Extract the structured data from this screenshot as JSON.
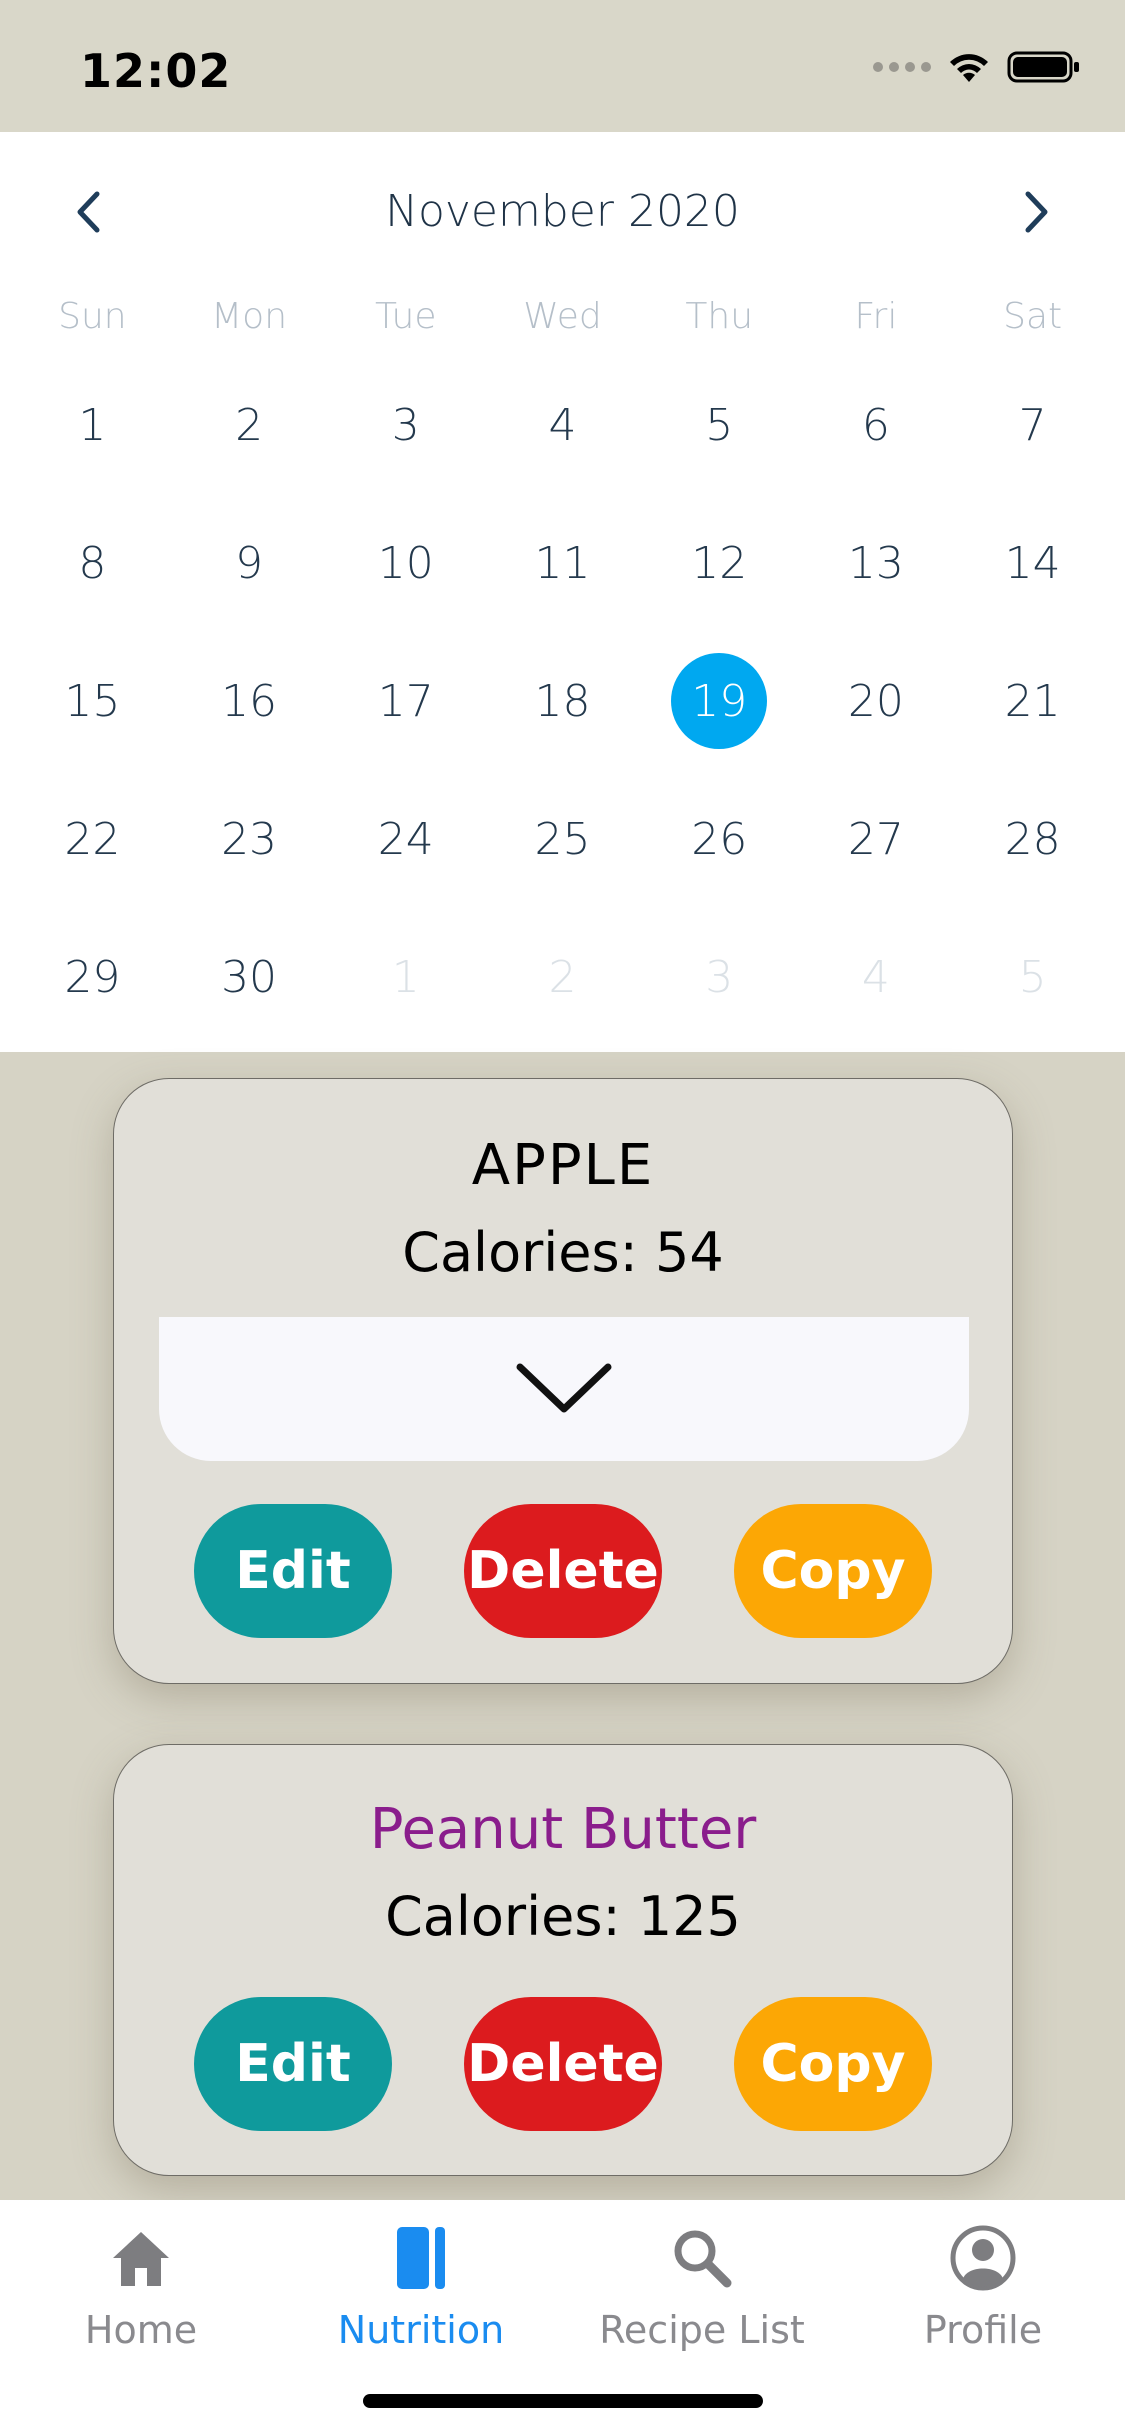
{
  "status_bar": {
    "time": "12:02"
  },
  "calendar": {
    "month_title": "November 2020",
    "weekdays": [
      "Sun",
      "Mon",
      "Tue",
      "Wed",
      "Thu",
      "Fri",
      "Sat"
    ],
    "days": [
      {
        "label": "1",
        "muted": false
      },
      {
        "label": "2",
        "muted": false
      },
      {
        "label": "3",
        "muted": false
      },
      {
        "label": "4",
        "muted": false
      },
      {
        "label": "5",
        "muted": false
      },
      {
        "label": "6",
        "muted": false
      },
      {
        "label": "7",
        "muted": false
      },
      {
        "label": "8",
        "muted": false
      },
      {
        "label": "9",
        "muted": false
      },
      {
        "label": "10",
        "muted": false
      },
      {
        "label": "11",
        "muted": false
      },
      {
        "label": "12",
        "muted": false
      },
      {
        "label": "13",
        "muted": false
      },
      {
        "label": "14",
        "muted": false
      },
      {
        "label": "15",
        "muted": false
      },
      {
        "label": "16",
        "muted": false
      },
      {
        "label": "17",
        "muted": false
      },
      {
        "label": "18",
        "muted": false
      },
      {
        "label": "19",
        "muted": false,
        "selected": true
      },
      {
        "label": "20",
        "muted": false
      },
      {
        "label": "21",
        "muted": false
      },
      {
        "label": "22",
        "muted": false
      },
      {
        "label": "23",
        "muted": false
      },
      {
        "label": "24",
        "muted": false
      },
      {
        "label": "25",
        "muted": false
      },
      {
        "label": "26",
        "muted": false
      },
      {
        "label": "27",
        "muted": false
      },
      {
        "label": "28",
        "muted": false
      },
      {
        "label": "29",
        "muted": false
      },
      {
        "label": "30",
        "muted": false
      },
      {
        "label": "1",
        "muted": true
      },
      {
        "label": "2",
        "muted": true
      },
      {
        "label": "3",
        "muted": true
      },
      {
        "label": "4",
        "muted": true
      },
      {
        "label": "5",
        "muted": true
      }
    ],
    "selected_color": "#00a8f0"
  },
  "entries": [
    {
      "name": "APPLE",
      "calories": "Calories: 54",
      "name_color": "#000000",
      "buttons": {
        "edit": "Edit",
        "delete": "Delete",
        "copy": "Copy"
      }
    },
    {
      "name": "Peanut Butter",
      "calories": "Calories: 125",
      "name_color": "#8a1d8c",
      "buttons": {
        "edit": "Edit",
        "delete": "Delete",
        "copy": "Copy"
      }
    }
  ],
  "button_colors": {
    "edit": "#0f9a9c",
    "delete": "#dc1b1e",
    "copy": "#fca705"
  },
  "tab_bar": {
    "tabs": [
      {
        "label": "Home",
        "icon": "home-icon",
        "active": false
      },
      {
        "label": "Nutrition",
        "icon": "book-icon",
        "active": true
      },
      {
        "label": "Recipe List",
        "icon": "search-icon",
        "active": false
      },
      {
        "label": "Profile",
        "icon": "profile-icon",
        "active": false
      }
    ],
    "active_color": "#1a8cf0"
  }
}
